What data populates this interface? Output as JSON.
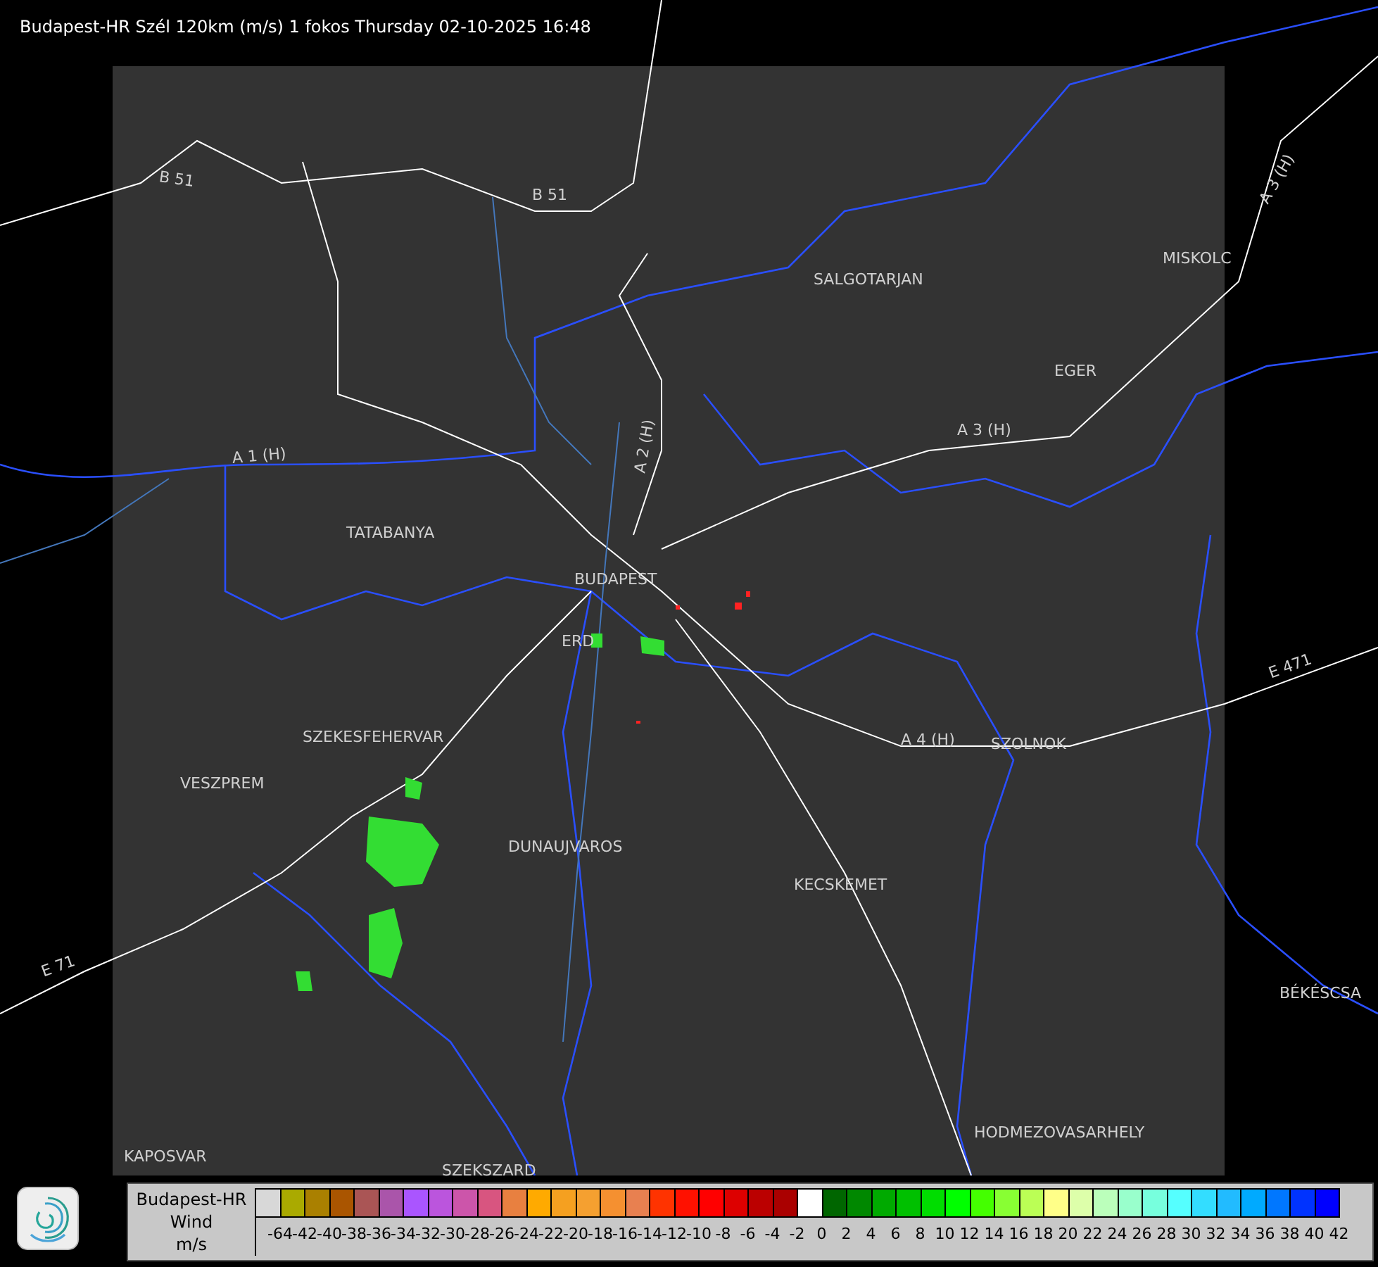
{
  "title": "Budapest-HR Szél 120km (m/s) 1 fokos Thursday 02-10-2025 16:48",
  "map": {
    "labels": [
      {
        "text": "B 51"
      },
      {
        "text": "B 51"
      },
      {
        "text": "SALGOTARJAN"
      },
      {
        "text": "MISKOLC"
      },
      {
        "text": "A 3 (H)"
      },
      {
        "text": "EGER"
      },
      {
        "text": "A 1 (H)"
      },
      {
        "text": "A 2 (H)"
      },
      {
        "text": "A 3 (H)"
      },
      {
        "text": "TATABANYA"
      },
      {
        "text": "BUDAPEST"
      },
      {
        "text": "ERD"
      },
      {
        "text": "A 4 (H)"
      },
      {
        "text": "SZOLNOK"
      },
      {
        "text": "E 471"
      },
      {
        "text": "SZEKESFEHERVAR"
      },
      {
        "text": "VESZPREM"
      },
      {
        "text": "DUNAUJVAROS"
      },
      {
        "text": "KECSKEMET"
      },
      {
        "text": "E 71"
      },
      {
        "text": "BÉKÉSCSA"
      },
      {
        "text": "HODMEZOVASARHELY"
      },
      {
        "text": "KAPOSVAR"
      },
      {
        "text": "SZEKSZARD"
      }
    ]
  },
  "legend": {
    "station": "Budapest-HR",
    "quantity": "Wind",
    "unit": "m/s",
    "items": [
      {
        "label": "-64",
        "color": "#d8d8d8"
      },
      {
        "label": "-42",
        "color": "#aaaa00"
      },
      {
        "label": "-40",
        "color": "#aa8000"
      },
      {
        "label": "-38",
        "color": "#aa5500"
      },
      {
        "label": "-36",
        "color": "#aa5555"
      },
      {
        "label": "-34",
        "color": "#aa55aa"
      },
      {
        "label": "-32",
        "color": "#aa55ff"
      },
      {
        "label": "-30",
        "color": "#bb55dd"
      },
      {
        "label": "-28",
        "color": "#cc55aa"
      },
      {
        "label": "-26",
        "color": "#d85580"
      },
      {
        "label": "-24",
        "color": "#e88040"
      },
      {
        "label": "-22",
        "color": "#ffaa00"
      },
      {
        "label": "-20",
        "color": "#f5a020"
      },
      {
        "label": "-18",
        "color": "#f5a030"
      },
      {
        "label": "-16",
        "color": "#f59030"
      },
      {
        "label": "-14",
        "color": "#e88050"
      },
      {
        "label": "-12",
        "color": "#ff3300"
      },
      {
        "label": "-10",
        "color": "#ff1100"
      },
      {
        "label": "-8",
        "color": "#ff0000"
      },
      {
        "label": "-6",
        "color": "#dd0000"
      },
      {
        "label": "-4",
        "color": "#bb0000"
      },
      {
        "label": "-2",
        "color": "#aa0000"
      },
      {
        "label": "0",
        "color": "#ffffff"
      },
      {
        "label": "2",
        "color": "#006600"
      },
      {
        "label": "4",
        "color": "#008800"
      },
      {
        "label": "6",
        "color": "#00aa00"
      },
      {
        "label": "8",
        "color": "#00c000"
      },
      {
        "label": "10",
        "color": "#00dd00"
      },
      {
        "label": "12",
        "color": "#00ff00"
      },
      {
        "label": "14",
        "color": "#44ff00"
      },
      {
        "label": "16",
        "color": "#88ff33"
      },
      {
        "label": "18",
        "color": "#bbff55"
      },
      {
        "label": "20",
        "color": "#ffff88"
      },
      {
        "label": "22",
        "color": "#ddffaa"
      },
      {
        "label": "24",
        "color": "#bbffbb"
      },
      {
        "label": "26",
        "color": "#99ffcc"
      },
      {
        "label": "28",
        "color": "#77ffdd"
      },
      {
        "label": "30",
        "color": "#55ffff"
      },
      {
        "label": "32",
        "color": "#33ddff"
      },
      {
        "label": "34",
        "color": "#22bbff"
      },
      {
        "label": "36",
        "color": "#00aaff"
      },
      {
        "label": "38",
        "color": "#0077ff"
      },
      {
        "label": "40",
        "color": "#0033ff"
      },
      {
        "label": "42",
        "color": "#0000ff"
      }
    ]
  }
}
